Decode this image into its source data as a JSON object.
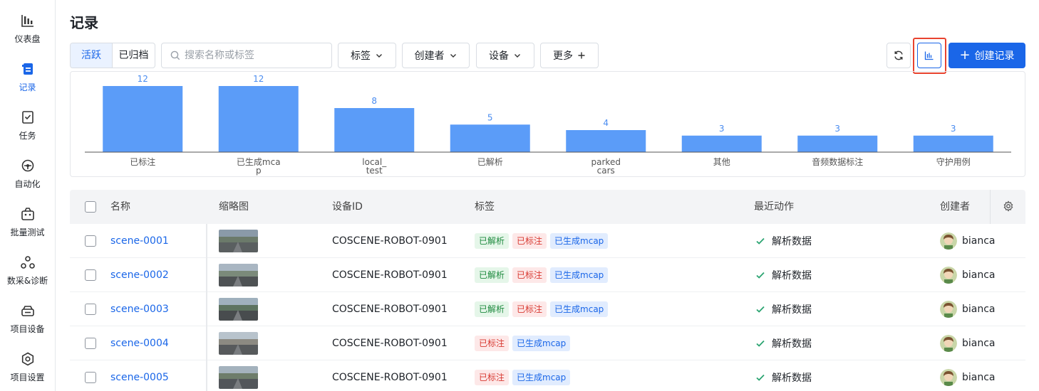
{
  "sidebar": {
    "items": [
      {
        "label": "仪表盘",
        "icon": "dashboard-icon",
        "active": false
      },
      {
        "label": "记录",
        "icon": "records-icon",
        "active": true
      },
      {
        "label": "任务",
        "icon": "tasks-icon",
        "active": false
      },
      {
        "label": "自动化",
        "icon": "automation-icon",
        "active": false
      },
      {
        "label": "批量测试",
        "icon": "batch-test-icon",
        "active": false
      },
      {
        "label": "数采&诊断",
        "icon": "diagnosis-icon",
        "active": false
      },
      {
        "label": "项目设备",
        "icon": "device-icon",
        "active": false
      },
      {
        "label": "项目设置",
        "icon": "settings-icon",
        "active": false
      }
    ]
  },
  "header": {
    "title": "记录"
  },
  "toolbar": {
    "seg_active": "活跃",
    "seg_archived": "已归档",
    "search_placeholder": "搜索名称或标签",
    "filters": {
      "tags": "标签",
      "creator": "创建者",
      "device": "设备",
      "more": "更多"
    },
    "create_label": "创建记录"
  },
  "colors": {
    "accent": "#1a66e8",
    "bar": "#5b9cf8",
    "highlight": "#e8432f"
  },
  "chart_data": {
    "type": "bar",
    "categories": [
      "已标注",
      "已生成mcap",
      "local_test",
      "已解析",
      "parked cars",
      "其他",
      "音频数据标注",
      "守护用例"
    ],
    "category_lines": [
      [
        "已标注"
      ],
      [
        "已生成mca",
        "p"
      ],
      [
        "local_",
        "test"
      ],
      [
        "已解析"
      ],
      [
        "parked",
        "cars"
      ],
      [
        "其他"
      ],
      [
        "音频数据标注"
      ],
      [
        "守护用例"
      ]
    ],
    "values": [
      12,
      12,
      8,
      5,
      4,
      3,
      3,
      3
    ],
    "ylim": [
      0,
      12
    ],
    "grid": false,
    "legend": "none"
  },
  "table": {
    "headers": {
      "name": "名称",
      "thumb": "缩略图",
      "device": "设备ID",
      "tags": "标签",
      "action": "最近动作",
      "creator": "创建者"
    },
    "rows": [
      {
        "name": "scene-0001",
        "device": "COSCENE-ROBOT-0901",
        "tags": [
          {
            "t": "已解析",
            "c": "g"
          },
          {
            "t": "已标注",
            "c": "r"
          },
          {
            "t": "已生成mcap",
            "c": "b"
          }
        ],
        "action": "解析数据",
        "creator": "bianca"
      },
      {
        "name": "scene-0002",
        "device": "COSCENE-ROBOT-0901",
        "tags": [
          {
            "t": "已解析",
            "c": "g"
          },
          {
            "t": "已标注",
            "c": "r"
          },
          {
            "t": "已生成mcap",
            "c": "b"
          }
        ],
        "action": "解析数据",
        "creator": "bianca"
      },
      {
        "name": "scene-0003",
        "device": "COSCENE-ROBOT-0901",
        "tags": [
          {
            "t": "已解析",
            "c": "g"
          },
          {
            "t": "已标注",
            "c": "r"
          },
          {
            "t": "已生成mcap",
            "c": "b"
          }
        ],
        "action": "解析数据",
        "creator": "bianca"
      },
      {
        "name": "scene-0004",
        "device": "COSCENE-ROBOT-0901",
        "tags": [
          {
            "t": "已标注",
            "c": "r"
          },
          {
            "t": "已生成mcap",
            "c": "b"
          }
        ],
        "action": "解析数据",
        "creator": "bianca"
      },
      {
        "name": "scene-0005",
        "device": "COSCENE-ROBOT-0901",
        "tags": [
          {
            "t": "已标注",
            "c": "r"
          },
          {
            "t": "已生成mcap",
            "c": "b"
          }
        ],
        "action": "解析数据",
        "creator": "bianca"
      }
    ]
  }
}
